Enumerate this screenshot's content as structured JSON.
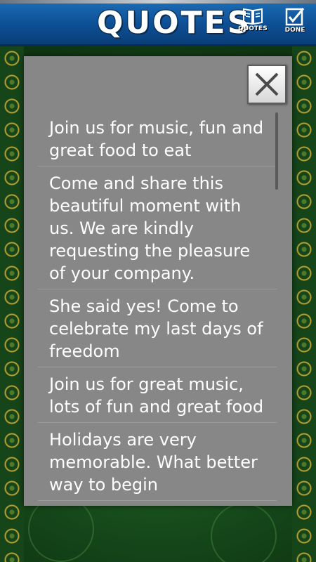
{
  "header": {
    "title": "QUOTES",
    "quotes_label": "QUOTES",
    "done_label": "DONE"
  },
  "icons": {
    "quotes": "book-icon",
    "done": "checkbox-icon",
    "close": "close-icon"
  },
  "colors": {
    "header_blue": "#0d4f95",
    "dialog_gray": "#878787",
    "background_green": "#1f5e22"
  },
  "quotes": [
    "Join us for music, fun and great food to eat",
    "Come and share this beautiful moment with us. We are kindly requesting the pleasure of your company.",
    "She said yes! Come to celebrate my last days of freedom",
    "Join us for great music, lots of fun and great food",
    "Holidays are very memorable. What better way to begin"
  ]
}
